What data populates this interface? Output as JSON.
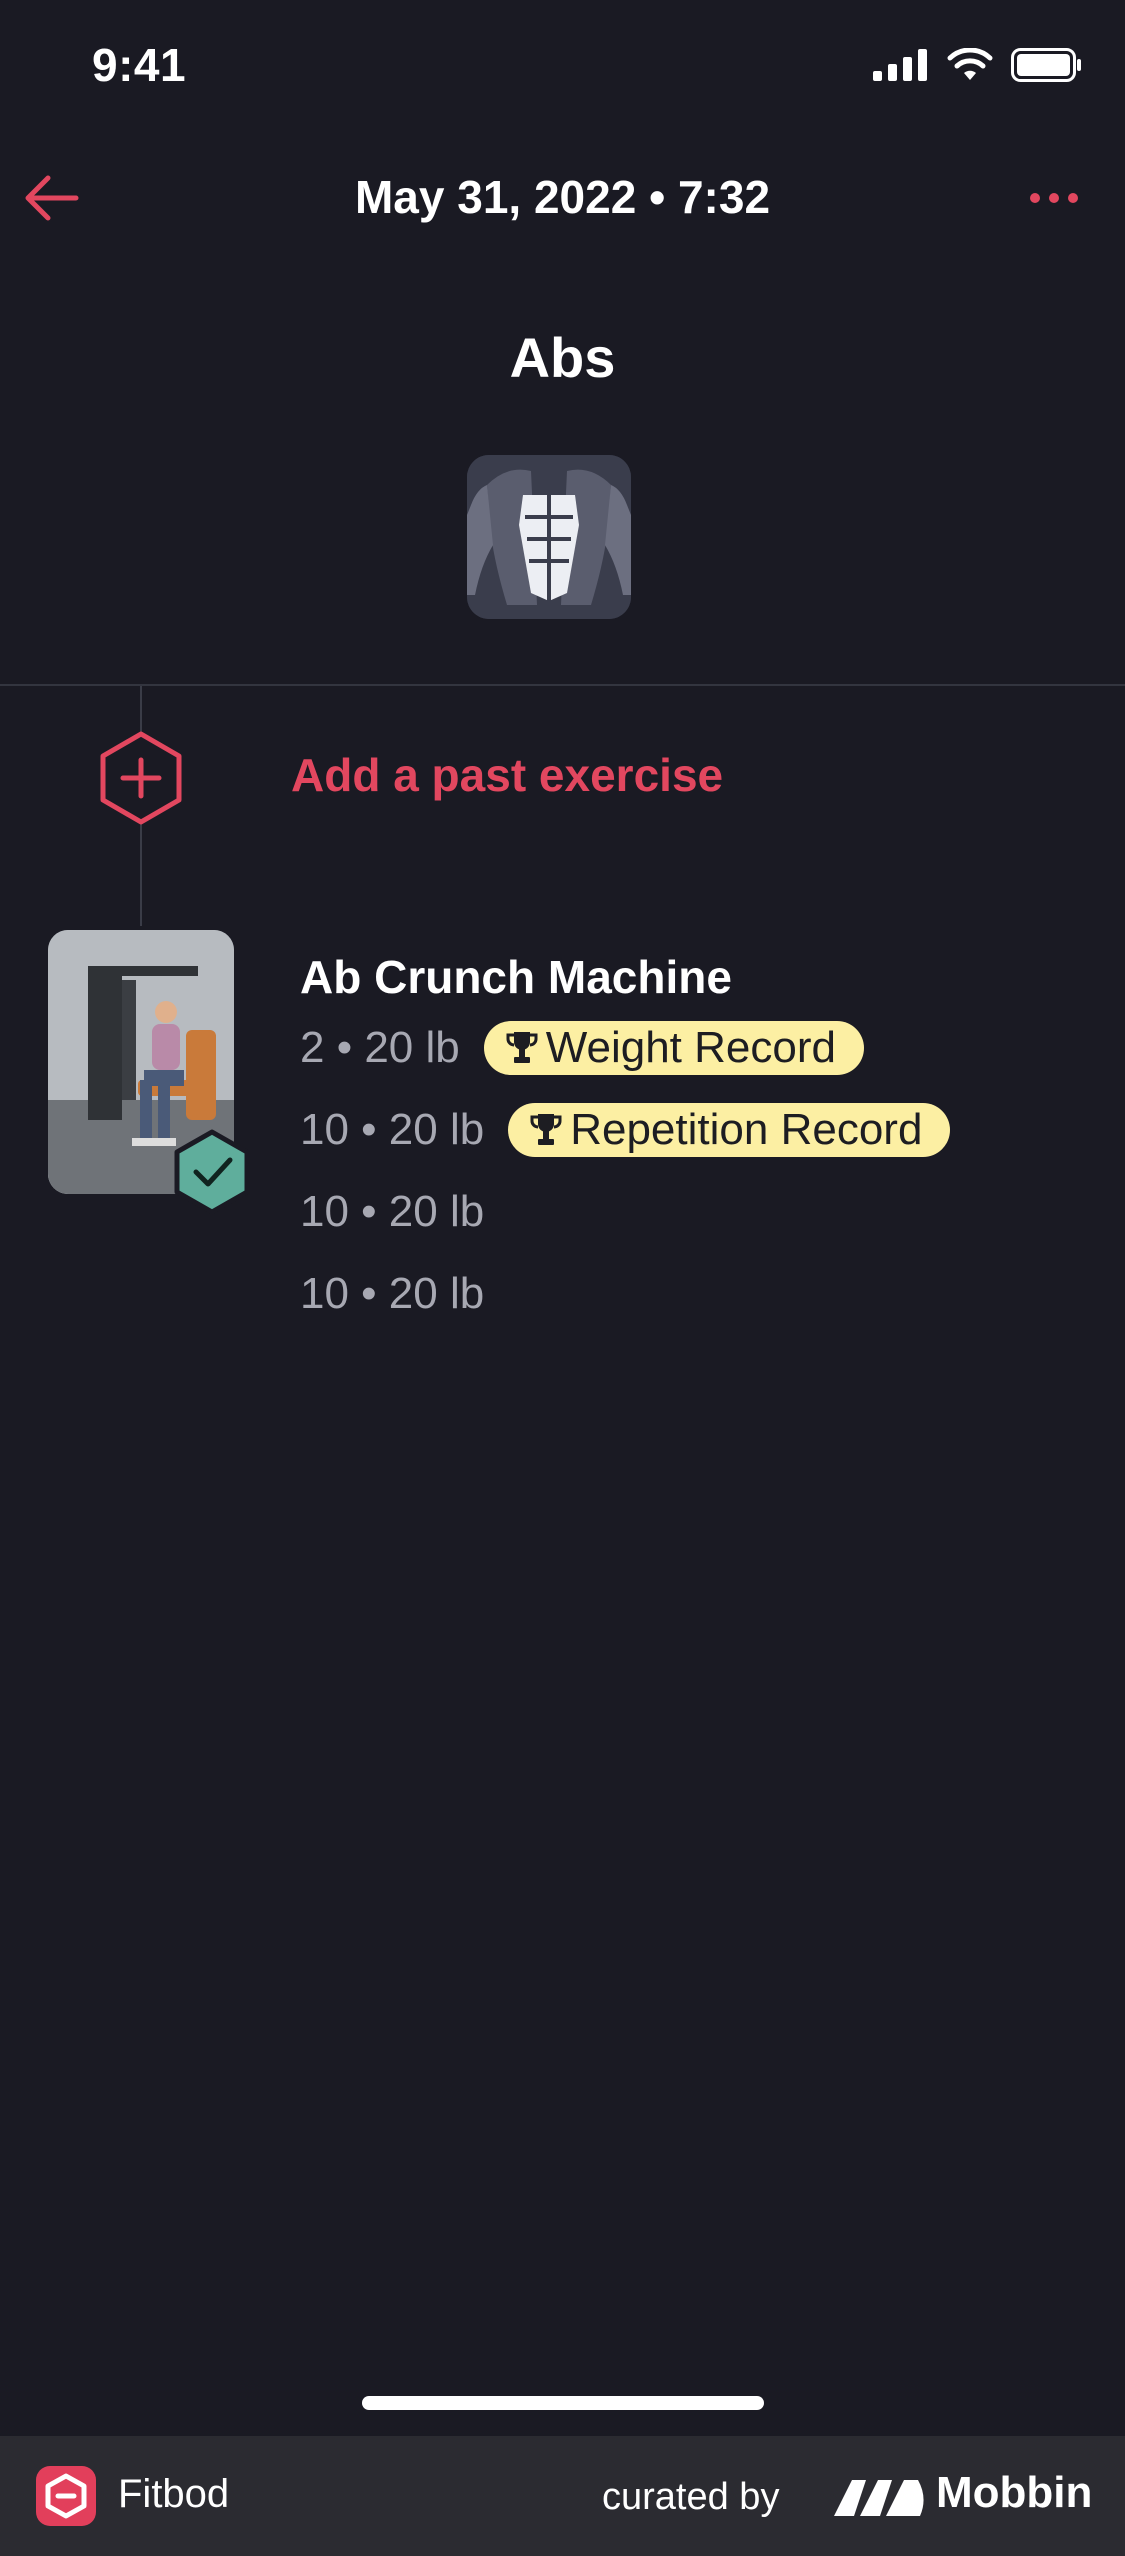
{
  "status_bar": {
    "time": "9:41"
  },
  "nav": {
    "title": "May 31, 2022 • 7:32"
  },
  "workout": {
    "title": "Abs"
  },
  "add_past_exercise": {
    "label": "Add a past exercise"
  },
  "exercise": {
    "name": "Ab Crunch Machine",
    "sets": [
      {
        "text": "2 • 20 lb",
        "badge": "Weight Record"
      },
      {
        "text": "10 • 20 lb",
        "badge": "Repetition Record"
      },
      {
        "text": "10 • 20 lb",
        "badge": null
      },
      {
        "text": "10 • 20 lb",
        "badge": null
      }
    ]
  },
  "footer": {
    "app_name": "Fitbod",
    "curated_by": "curated by",
    "brand": "Mobbin"
  },
  "colors": {
    "accent": "#e2475f",
    "background": "#1a1a23",
    "badge": "#fcefa3",
    "check_badge": "#5fae9c"
  }
}
